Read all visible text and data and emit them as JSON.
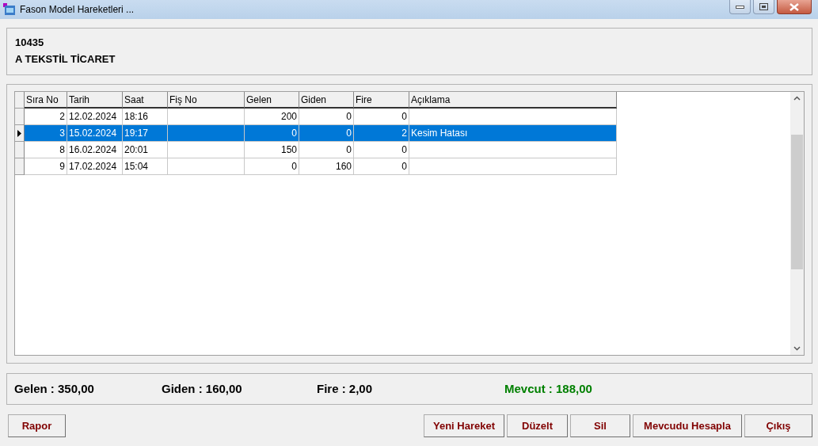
{
  "window": {
    "title": "Fason Model Hareketleri ..."
  },
  "header": {
    "code": "10435",
    "company": "A TEKSTİL TİCARET"
  },
  "table": {
    "columns": [
      "Sıra No",
      "Tarih",
      "Saat",
      "Fiş No",
      "Gelen",
      "Giden",
      "Fire",
      "Açıklama"
    ],
    "rows": [
      {
        "cells": [
          "2",
          "12.02.2024",
          "18:16",
          "",
          "200",
          "0",
          "0",
          ""
        ],
        "selected": false
      },
      {
        "cells": [
          "3",
          "15.02.2024",
          "19:17",
          "",
          "0",
          "0",
          "2",
          "Kesim Hatası"
        ],
        "selected": true
      },
      {
        "cells": [
          "8",
          "16.02.2024",
          "20:01",
          "",
          "150",
          "0",
          "0",
          ""
        ],
        "selected": false
      },
      {
        "cells": [
          "9",
          "17.02.2024",
          "15:04",
          "",
          "0",
          "160",
          "0",
          ""
        ],
        "selected": false
      }
    ]
  },
  "totals": [
    {
      "text": "Gelen : 350,00",
      "color": "#000000"
    },
    {
      "text": "Giden : 160,00",
      "color": "#000000"
    },
    {
      "text": "Fire : 2,00",
      "color": "#000000"
    },
    {
      "text": "Mevcut : 188,00",
      "color": "#008000"
    }
  ],
  "buttons_left": [
    "Rapor"
  ],
  "buttons_right": [
    "Yeni Hareket",
    "Düzelt",
    "Sil",
    "Mevcudu Hesapla",
    "Çıkış"
  ]
}
